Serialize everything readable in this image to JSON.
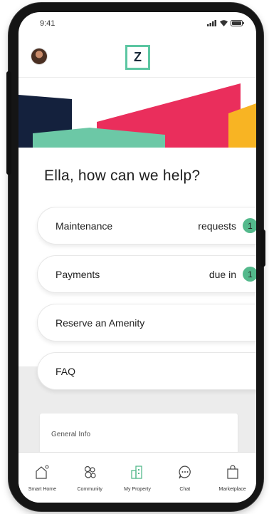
{
  "status_bar": {
    "time": "9:41"
  },
  "header": {
    "logo_letter": "Z"
  },
  "greeting": "Ella, how can we help?",
  "menu": [
    {
      "label": "Maintenance",
      "right_text": "requests",
      "badge": "1"
    },
    {
      "label": "Payments",
      "right_text": "due in",
      "badge": "1"
    },
    {
      "label": "Reserve an Amenity"
    },
    {
      "label": "FAQ"
    }
  ],
  "info_card": {
    "title": "General Info"
  },
  "tabs": [
    {
      "label": "Smart Home",
      "icon": "smart-home-icon"
    },
    {
      "label": "Community",
      "icon": "community-icon"
    },
    {
      "label": "My Property",
      "icon": "my-property-icon",
      "active": true
    },
    {
      "label": "Chat",
      "icon": "chat-icon"
    },
    {
      "label": "Marketplace",
      "icon": "marketplace-icon"
    }
  ],
  "colors": {
    "accent": "#54b98c",
    "logo_border": "#5cc6a2",
    "banner_navy": "#14213d",
    "banner_pink": "#ea2e5c",
    "banner_yellow": "#f8b423",
    "banner_mint": "#6cc8a6"
  }
}
